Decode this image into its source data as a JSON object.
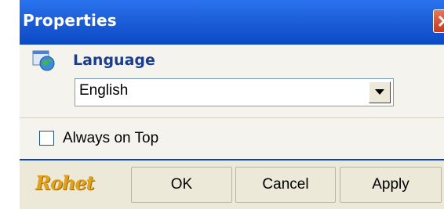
{
  "window": {
    "title": "Properties"
  },
  "language": {
    "label": "Language",
    "icon": "globe-window-icon",
    "selected": "English"
  },
  "options": {
    "always_on_top_label": "Always on Top",
    "always_on_top_checked": false
  },
  "footer": {
    "logo_text": "Rohet",
    "ok_label": "OK",
    "cancel_label": "Cancel",
    "apply_label": "Apply"
  },
  "colors": {
    "titlebar": "#1d5fd8",
    "accent_label": "#1c3d8e",
    "close_button": "#d35030",
    "footer_border": "#0a3fb5",
    "logo": "#e0a21c"
  }
}
